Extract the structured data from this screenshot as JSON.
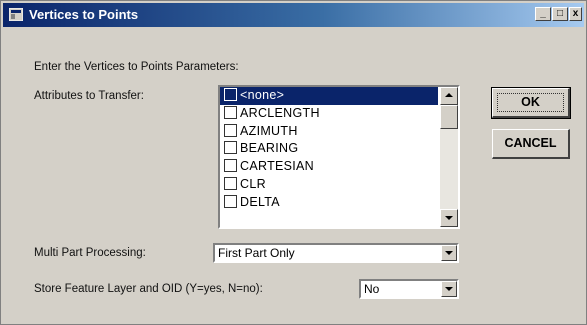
{
  "window": {
    "title": "Vertices to Points",
    "minimize_label": "_",
    "maximize_label": "□",
    "close_label": "x"
  },
  "form": {
    "prompt": "Enter the Vertices to Points Parameters:",
    "attributes_label": "Attributes to Transfer:",
    "attributes": [
      {
        "label": "<none>",
        "checked": false,
        "selected": true
      },
      {
        "label": "ARCLENGTH",
        "checked": false,
        "selected": false
      },
      {
        "label": "AZIMUTH",
        "checked": false,
        "selected": false
      },
      {
        "label": "BEARING",
        "checked": false,
        "selected": false
      },
      {
        "label": "CARTESIAN",
        "checked": false,
        "selected": false
      },
      {
        "label": "CLR",
        "checked": false,
        "selected": false
      },
      {
        "label": "DELTA",
        "checked": false,
        "selected": false
      }
    ],
    "multipart_label": "Multi Part Processing:",
    "multipart_value": "First Part Only",
    "store_label": "Store Feature Layer and OID (Y=yes, N=no):",
    "store_value": "No"
  },
  "buttons": {
    "ok_label": "OK",
    "cancel_label": "CANCEL"
  },
  "colors": {
    "titlebar_start": "#0a246a",
    "titlebar_end": "#a6caf0",
    "selection": "#0a246a",
    "face": "#d4d0c8"
  }
}
